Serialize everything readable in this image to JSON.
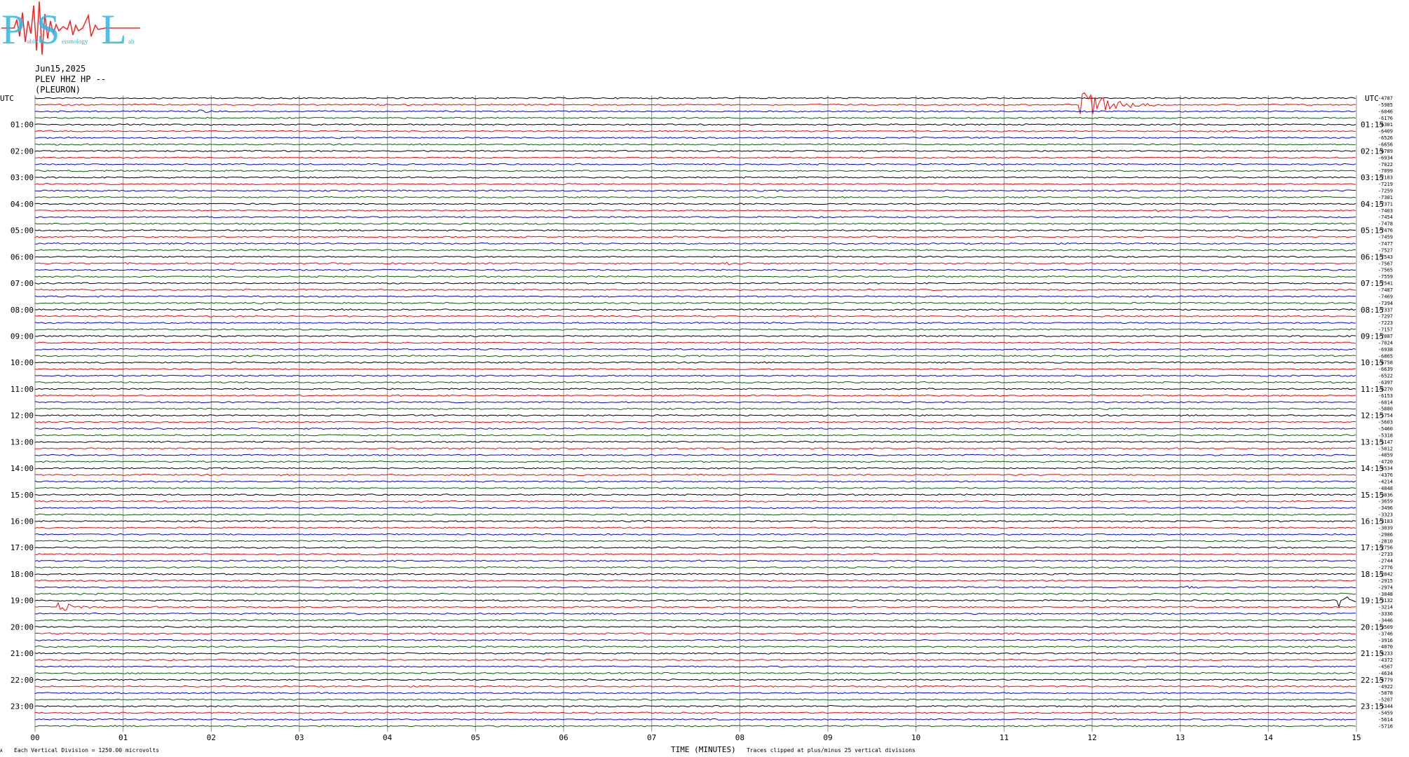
{
  "logo": {
    "letters": [
      "P",
      "S",
      "L"
    ],
    "subtext": [
      "ublic",
      "eismology",
      "ab"
    ]
  },
  "header": {
    "date": "Jun15,2025",
    "channel": "PLEV HHZ HP --",
    "station": "(PLEURON)"
  },
  "footer": {
    "scale_note": "Each Vertical Division = 1250.00 microvolts",
    "xlabel": "TIME (MINUTES)",
    "clip_note": "Traces clipped at plus/minus 25 vertical divisions",
    "corner_mark": "A"
  },
  "colors": {
    "black": "#000000",
    "red": "#ff0000",
    "blue": "#0000ff",
    "green": "#006400",
    "grid": "#a0a0a0",
    "logo_blue": "#29b6e8",
    "logo_red": "#ff2020"
  },
  "chart_data": {
    "type": "line",
    "title": "",
    "xlabel": "TIME (MINUTES)",
    "xlim": [
      0,
      15
    ],
    "x_ticks": [
      "00",
      "01",
      "02",
      "03",
      "04",
      "05",
      "06",
      "07",
      "08",
      "09",
      "10",
      "11",
      "12",
      "13",
      "14",
      "15"
    ],
    "trace_color_cycle": [
      "black",
      "red",
      "blue",
      "green"
    ],
    "left_axis_title": "UTC",
    "right_axis_title": "UTC",
    "left_hour_labels": [
      "01:00",
      "02:00",
      "03:00",
      "04:00",
      "05:00",
      "06:00",
      "07:00",
      "08:00",
      "09:00",
      "10:00",
      "11:00",
      "12:00",
      "13:00",
      "14:00",
      "15:00",
      "16:00",
      "17:00",
      "18:00",
      "19:00",
      "20:00",
      "21:00",
      "22:00",
      "23:00"
    ],
    "right_hour_labels": [
      "01:15",
      "02:15",
      "03:15",
      "04:15",
      "05:15",
      "06:15",
      "07:15",
      "08:15",
      "09:15",
      "10:15",
      "11:15",
      "12:15",
      "13:15",
      "14:15",
      "15:15",
      "16:15",
      "17:15",
      "18:15",
      "19:15",
      "20:15",
      "21:15",
      "22:15",
      "23:15"
    ],
    "trace_offsets": [
      -4787,
      -5985,
      -6046,
      -6176,
      -6301,
      -6409,
      -6526,
      -6656,
      -6789,
      -6934,
      -7022,
      -7099,
      -7183,
      -7219,
      -7259,
      -7301,
      -7371,
      -7403,
      -7454,
      -7478,
      -7476,
      -7459,
      -7477,
      -7527,
      -7543,
      -7567,
      -7565,
      -7559,
      -7541,
      -7487,
      -7469,
      -7394,
      -7337,
      -7297,
      -7223,
      -7157,
      -7087,
      -7024,
      -6938,
      -6865,
      -6758,
      -6639,
      -6522,
      -6397,
      -6270,
      -6153,
      -6014,
      -5880,
      -5754,
      -5603,
      -5460,
      -5318,
      -5147,
      -5012,
      -4859,
      -4720,
      -4534,
      -4376,
      -4214,
      -4048,
      -3836,
      -3659,
      -3496,
      -3323,
      -3183,
      -3039,
      -2986,
      -2810,
      -2756,
      -2733,
      -2744,
      -2776,
      -2842,
      -2915,
      -2974,
      -3048,
      -3132,
      -3214,
      -3336,
      -3446,
      -3509,
      -3746,
      -3916,
      -4070,
      -4233,
      -4372,
      -4567,
      -4634,
      -4779,
      -4922,
      -5078,
      -5207,
      -5344,
      -5459,
      -5614,
      -5716
    ],
    "events": [
      {
        "trace": 1,
        "minute": 11.9,
        "amplitude": 2.2,
        "duration": 0.9
      },
      {
        "trace": 2,
        "minute": 1.9,
        "amplitude": 0.3,
        "duration": 0.2
      },
      {
        "trace": 5,
        "minute": 9.9,
        "amplitude": 0.25,
        "duration": 0.2
      },
      {
        "trace": 17,
        "minute": 12.75,
        "amplitude": 0.3,
        "duration": 0.15
      },
      {
        "trace": 25,
        "minute": 7.9,
        "amplitude": 0.3,
        "duration": 0.25
      },
      {
        "trace": 74,
        "minute": 13.1,
        "amplitude": 0.25,
        "duration": 0.25
      },
      {
        "trace": 76,
        "minute": 14.85,
        "amplitude": 0.9,
        "duration": 0.3
      },
      {
        "trace": 77,
        "minute": 0.3,
        "amplitude": 0.8,
        "duration": 0.5
      }
    ]
  }
}
